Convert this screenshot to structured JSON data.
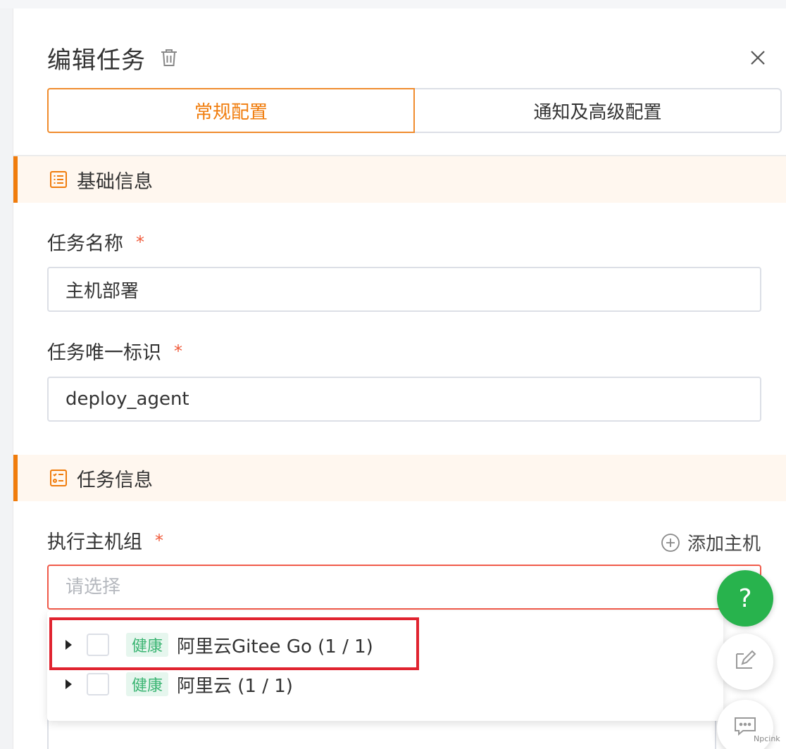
{
  "dialog": {
    "title": "编辑任务",
    "tabs": [
      {
        "label": "常规配置",
        "active": true
      },
      {
        "label": "通知及高级配置",
        "active": false
      }
    ]
  },
  "sections": {
    "basic": "基础信息",
    "task": "任务信息"
  },
  "fields": {
    "task_name": {
      "label": "任务名称",
      "required": "*",
      "value": "主机部署"
    },
    "task_id": {
      "label": "任务唯一标识",
      "required": "*",
      "value": "deploy_agent"
    },
    "host_group": {
      "label": "执行主机组",
      "required": "*",
      "placeholder": "请选择"
    }
  },
  "actions": {
    "add_host": "添加主机"
  },
  "dropdown": {
    "items": [
      {
        "status": "健康",
        "name": "阿里云Gitee Go (1 / 1)"
      },
      {
        "status": "健康",
        "name": "阿里云 (1 / 1)"
      }
    ]
  },
  "floating": {
    "help": "?"
  },
  "watermark": "Npcink",
  "colors": {
    "accent": "#f07c0c",
    "healthy_text": "#3bb573",
    "healthy_bg": "#e6f6ee",
    "error": "#f05a4a",
    "help_green": "#28b34d",
    "highlight_red": "#e0232f"
  }
}
